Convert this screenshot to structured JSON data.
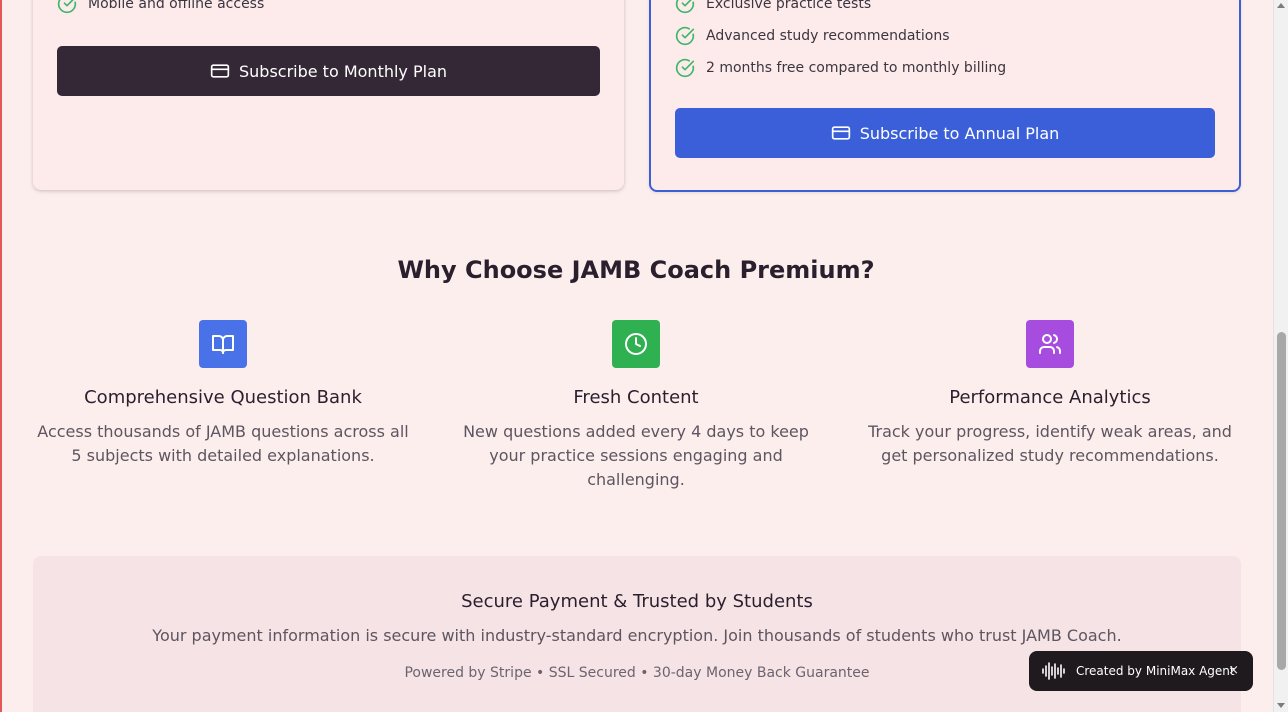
{
  "monthly_plan": {
    "features": [
      "Mobile and offline access"
    ],
    "button_label": "Subscribe to Monthly Plan"
  },
  "annual_plan": {
    "features": [
      "Exclusive practice tests",
      "Advanced study recommendations",
      "2 months free compared to monthly billing"
    ],
    "button_label": "Subscribe to Annual Plan"
  },
  "why": {
    "title": "Why Choose JAMB Coach Premium?",
    "items": [
      {
        "icon": "book-open-icon",
        "color": "#4a72e8",
        "title": "Comprehensive Question Bank",
        "description": "Access thousands of JAMB questions across all 5 subjects with detailed explanations."
      },
      {
        "icon": "clock-icon",
        "color": "#2fb152",
        "title": "Fresh Content",
        "description": "New questions added every 4 days to keep your practice sessions engaging and challenging."
      },
      {
        "icon": "users-icon",
        "color": "#a64de0",
        "title": "Performance Analytics",
        "description": "Track your progress, identify weak areas, and get personalized study recommendations."
      }
    ]
  },
  "trust": {
    "title": "Secure Payment & Trusted by Students",
    "description": "Your payment information is secure with industry-standard encryption. Join thousands of students who trust JAMB Coach.",
    "footer": "Powered by Stripe • SSL Secured • 30-day Money Back Guarantee"
  },
  "badge": {
    "label": "Created by MiniMax Agent",
    "close": "×"
  },
  "colors": {
    "accent_blue": "#3b5fd9",
    "dark_button": "#342836",
    "check_green": "#3fb66a"
  }
}
